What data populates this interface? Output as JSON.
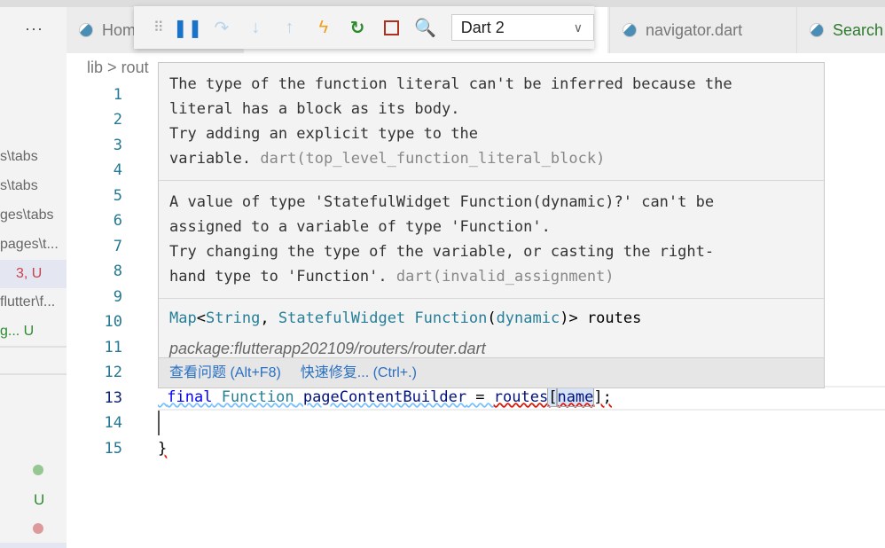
{
  "sidebar": {
    "more": "···",
    "items": [
      "s\\tabs",
      "s\\tabs",
      "ges\\tabs",
      "pages\\t...",
      "3, U",
      "flutter\\f...",
      "g...   U"
    ],
    "badges": {
      "u": "U"
    }
  },
  "tabs": [
    {
      "label": "Home"
    },
    {
      "label": "navigator.dart"
    },
    {
      "label": "Search"
    }
  ],
  "debug": {
    "target": "Dart 2",
    "icons": [
      "drag-handle",
      "pause",
      "step-over",
      "step-into",
      "step-out",
      "hot-reload",
      "restart",
      "stop",
      "flutter-inspector"
    ]
  },
  "breadcrumb": {
    "root": "lib",
    "sep": ">",
    "next": "rout"
  },
  "gutter": [
    "1",
    "2",
    "3",
    "4",
    "5",
    "6",
    "7",
    "8",
    "9",
    "10",
    "11",
    "12",
    "13",
    "14",
    "15"
  ],
  "code": {
    "line13": {
      "kw": "final",
      "type": "Function",
      "name": "pageContentBuilder",
      "op": " = ",
      "target": "routes",
      "open": "[",
      "key": "name",
      "close": "];"
    },
    "line15": "}"
  },
  "hover": {
    "p1": [
      "The type of the function literal can't be inferred because the",
      "literal has a block as its body.",
      "Try adding an explicit type to the",
      "variable."
    ],
    "p1_code": "dart(top_level_function_literal_block)",
    "p2": [
      "A value of type 'StatefulWidget Function(dynamic)?' can't be",
      "assigned to a variable of type 'Function'.",
      "Try changing the type of the variable, or casting the right-",
      "hand type to 'Function'."
    ],
    "p2_code": "dart(invalid_assignment)",
    "sig": {
      "a": "Map",
      "b": "<",
      "c": "String",
      "d": ", ",
      "e": "StatefulWidget",
      "f": " ",
      "g": "Function",
      "h": "(",
      "i": "dynamic",
      "j": ")> ",
      "k": "routes"
    },
    "package": "package:flutterapp202109/routers/router.dart",
    "view_problem": "查看问题 (Alt+F8)",
    "quick_fix": "快速修复... (Ctrl+.)"
  },
  "colors": {
    "accent": "#2a70c2",
    "error": "#e51400",
    "info": "#75beff"
  }
}
